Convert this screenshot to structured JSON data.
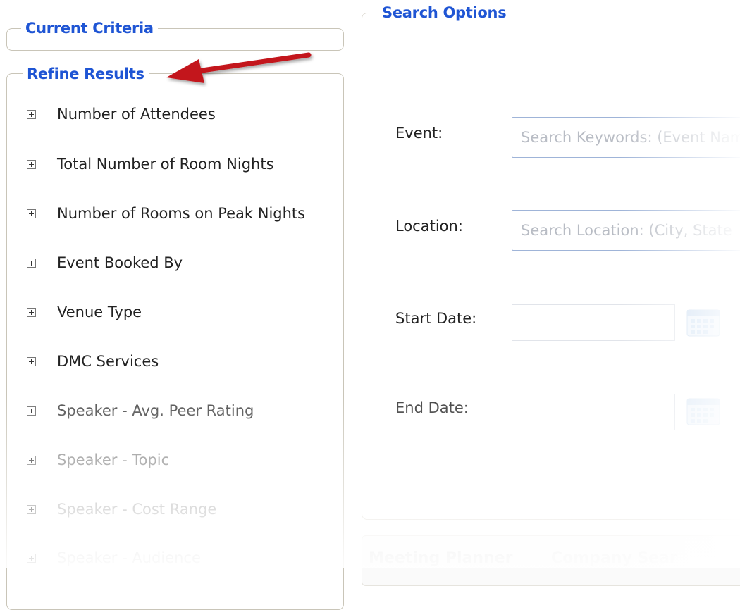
{
  "current_criteria": {
    "title": "Current Criteria"
  },
  "refine_results": {
    "title": "Refine Results",
    "items": [
      "Number of Attendees",
      "Total Number of Room Nights",
      "Number of Rooms on Peak Nights",
      "Event Booked By",
      "Venue Type",
      "DMC Services",
      "Speaker - Avg. Peer Rating",
      "Speaker - Topic",
      "Speaker - Cost Range",
      "Speaker - Audience"
    ]
  },
  "search_options": {
    "title": "Search Options",
    "event_label": "Event:",
    "event_placeholder": "Search Keywords:  (Event Name",
    "location_label": "Location:",
    "location_placeholder": "Search Location:  (City, State",
    "start_label": "Start Date:",
    "end_label": "End Date:"
  },
  "bottom_tabs": [
    "Meeting Planner",
    "Company Sear"
  ],
  "colors": {
    "legend": "#1f55d4",
    "arrow": "#c3141b"
  }
}
